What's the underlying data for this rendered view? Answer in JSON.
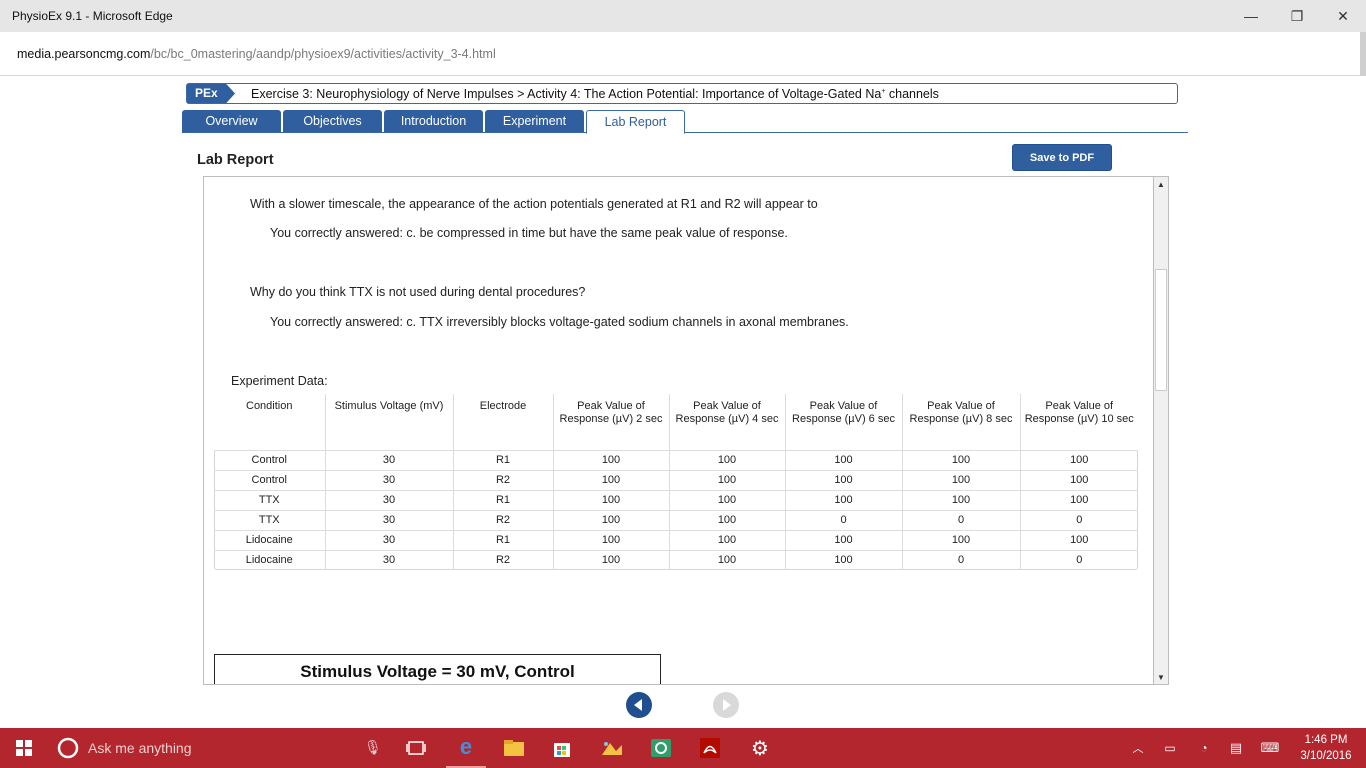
{
  "window": {
    "title": "PhysioEx 9.1 - Microsoft Edge",
    "url_domain": "media.pearsoncmg.com",
    "url_path": "/bc/bc_0mastering/aandp/physioex9/activities/activity_3-4.html"
  },
  "header": {
    "badge": "PEx",
    "title": "Exercise 3: Neurophysiology of Nerve Impulses > Activity 4: The Action Potential: Importance of Voltage-Gated Na",
    "title_sup": "+",
    "title_tail": " channels"
  },
  "tabs": [
    {
      "label": "Overview"
    },
    {
      "label": "Objectives"
    },
    {
      "label": "Introduction"
    },
    {
      "label": "Experiment"
    },
    {
      "label": "Lab Report"
    }
  ],
  "page": {
    "title": "Lab Report",
    "save_button": "Save to PDF"
  },
  "questions": [
    {
      "question": "With a slower timescale, the appearance of the action potentials generated at R1 and R2 will appear to",
      "answer": "You correctly answered: c. be compressed in time but have the same peak value of response."
    },
    {
      "question": "Why do you think TTX is not used during dental procedures?",
      "answer": "You correctly answered: c. TTX irreversibly blocks voltage-gated sodium channels in axonal membranes."
    }
  ],
  "experiment": {
    "label": "Experiment Data:",
    "headers": [
      "Condition",
      "Stimulus Voltage (mV)",
      "Electrode",
      "Peak Value of Response (µV) 2 sec",
      "Peak Value of Response (µV) 4 sec",
      "Peak Value of Response (µV) 6 sec",
      "Peak Value of Response (µV) 8 sec",
      "Peak Value of Response (µV) 10 sec"
    ],
    "rows": [
      [
        "Control",
        "30",
        "R1",
        "100",
        "100",
        "100",
        "100",
        "100"
      ],
      [
        "Control",
        "30",
        "R2",
        "100",
        "100",
        "100",
        "100",
        "100"
      ],
      [
        "TTX",
        "30",
        "R1",
        "100",
        "100",
        "100",
        "100",
        "100"
      ],
      [
        "TTX",
        "30",
        "R2",
        "100",
        "100",
        "0",
        "0",
        "0"
      ],
      [
        "Lidocaine",
        "30",
        "R1",
        "100",
        "100",
        "100",
        "100",
        "100"
      ],
      [
        "Lidocaine",
        "30",
        "R2",
        "100",
        "100",
        "100",
        "0",
        "0"
      ]
    ]
  },
  "graph": {
    "title": "Stimulus Voltage = 30 mV, Control"
  },
  "taskbar": {
    "search_placeholder": "Ask me anything",
    "time": "1:46 PM",
    "date": "3/10/2016"
  }
}
